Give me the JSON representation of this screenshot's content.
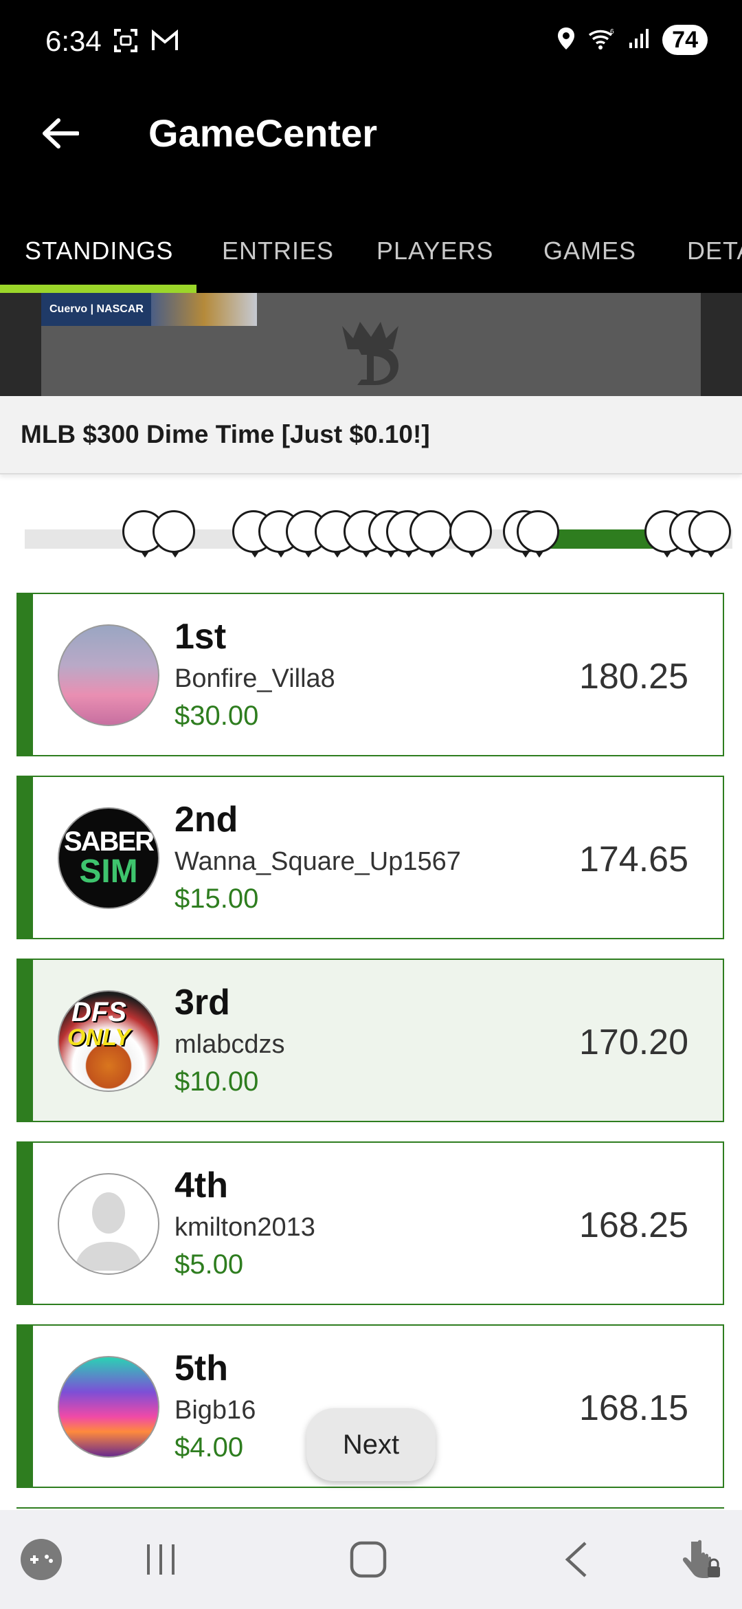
{
  "status_bar": {
    "time": "6:34",
    "battery": "74",
    "icons_left": [
      "screenshot-icon",
      "gmail-icon"
    ],
    "icons_right": [
      "location-icon",
      "wifi-icon",
      "signal-icon",
      "battery-icon"
    ]
  },
  "app_bar": {
    "title": "GameCenter",
    "back_icon": "arrow-left-icon"
  },
  "tabs": [
    {
      "label": "STANDINGS",
      "active": true
    },
    {
      "label": "ENTRIES",
      "active": false
    },
    {
      "label": "PLAYERS",
      "active": false
    },
    {
      "label": "GAMES",
      "active": false
    },
    {
      "label": "DETA",
      "active": false
    }
  ],
  "banner": {
    "ad_text": "Cuervo | NASCAR",
    "logo": "draftkings-crown-logo"
  },
  "contest": {
    "title": "MLB $300 Dime Time [Just $0.10!]"
  },
  "standings": [
    {
      "rank": "1st",
      "username": "Bonfire_Villa8",
      "prize": "$30.00",
      "points": "180.25",
      "highlighted": false,
      "avatar": "sunset-sky-avatar"
    },
    {
      "rank": "2nd",
      "username": "Wanna_Square_Up1567",
      "prize": "$15.00",
      "points": "174.65",
      "highlighted": false,
      "avatar": "sabersim-avatar",
      "avatar_text_1": "SABER",
      "avatar_text_2": "SIM"
    },
    {
      "rank": "3rd",
      "username": "mlabcdzs",
      "prize": "$10.00",
      "points": "170.20",
      "highlighted": true,
      "avatar": "dfs-only-avatar",
      "avatar_text_1": "DFS",
      "avatar_text_2": "ONLY"
    },
    {
      "rank": "4th",
      "username": "kmilton2013",
      "prize": "$5.00",
      "points": "168.25",
      "highlighted": false,
      "avatar": "default-person-avatar"
    },
    {
      "rank": "5th",
      "username": "Bigb16",
      "prize": "$4.00",
      "points": "168.15",
      "highlighted": false,
      "avatar": "tropical-sunset-avatar"
    }
  ],
  "next_button": {
    "label": "Next"
  },
  "nav_bar": [
    "game-launcher-icon",
    "recent-apps-icon",
    "home-icon",
    "back-icon",
    "touch-lock-icon"
  ],
  "colors": {
    "accent_green": "#2e7d1f",
    "tab_indicator": "#9bd62a",
    "highlight_bg": "#eef4ec"
  }
}
